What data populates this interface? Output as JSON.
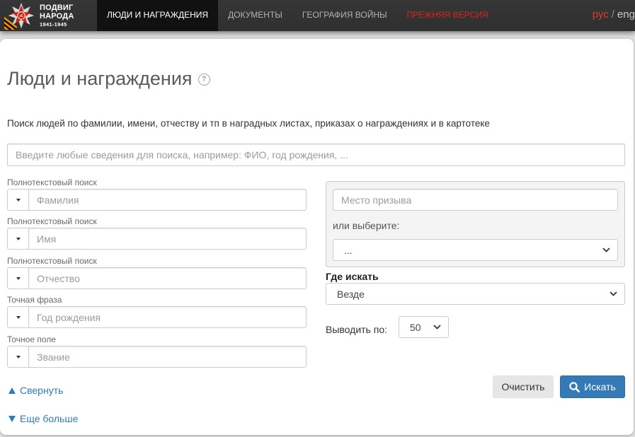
{
  "header": {
    "logo": {
      "icon": "medal-logo-icon",
      "lines": [
        "ПОДВИГ",
        "НАРОДА",
        "1941-1945"
      ]
    },
    "nav": [
      {
        "label": "ЛЮДИ И НАГРАЖДЕНИЯ",
        "active": true
      },
      {
        "label": "ДОКУМЕНТЫ",
        "active": false
      },
      {
        "label": "ГЕОГРАФИЯ ВОЙНЫ",
        "active": false
      },
      {
        "label": "ПРЕЖНЯЯ ВЕРСИЯ",
        "active": false
      }
    ],
    "lang": {
      "current": "рус",
      "separator": "/",
      "other": "eng"
    }
  },
  "page": {
    "title": "Люди и награждения",
    "help_icon": {
      "name": "help-icon",
      "glyph": "?"
    },
    "description": "Поиск людей по фамилии, имени, отчеству и тп в наградных листах, приказах о награждениях и в картотеке",
    "search": {
      "placeholder": "Введите любые сведения для поиска, например: ФИО, год рождения, ...",
      "value": ""
    }
  },
  "person_fields": [
    {
      "mode": "Полнотекстовый поиск",
      "placeholder": "Фамилия",
      "value": ""
    },
    {
      "mode": "Полнотекстовый поиск",
      "placeholder": "Имя",
      "value": ""
    },
    {
      "mode": "Полнотекстовый поиск",
      "placeholder": "Отчество",
      "value": ""
    },
    {
      "mode": "Точная фраза",
      "placeholder": "Год рождения",
      "value": ""
    },
    {
      "mode": "Точное поле",
      "placeholder": "Звание",
      "value": ""
    }
  ],
  "conscription": {
    "placeholder": "Место призыва",
    "value": "",
    "or_label": "или выберите:",
    "selected": "..."
  },
  "where": {
    "label": "Где искать",
    "selected": "Везде"
  },
  "per_page": {
    "label": "Выводить по:",
    "selected": "50"
  },
  "links": {
    "collapse": {
      "icon": "triangle-up-icon",
      "label": "Свернуть"
    },
    "more": {
      "icon": "triangle-down-icon",
      "label": "Еще больше"
    }
  },
  "buttons": {
    "clear": {
      "label": "Очистить"
    },
    "search": {
      "label": "Искать",
      "icon": "search-icon"
    }
  },
  "colors": {
    "navbar": "#2f2f2f",
    "nav_active": "#111111",
    "nav_highlight": "#d8261f",
    "lang_active": "#e23b32",
    "accent": "#337ab7",
    "link": "#2c7cc0"
  }
}
